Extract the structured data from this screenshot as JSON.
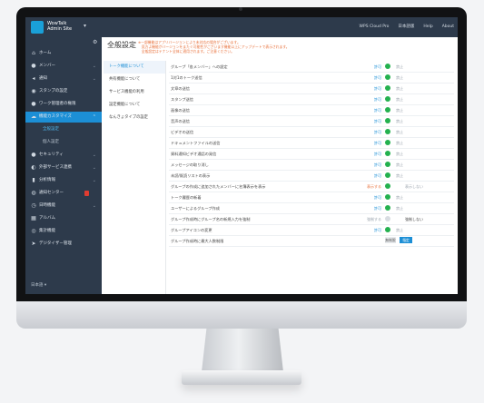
{
  "app": {
    "logo": {
      "line1": "WowTalk",
      "line2": "Admin Site"
    },
    "top_links": [
      "WPS Cloud Pro",
      "日本語版",
      "Help",
      "About"
    ]
  },
  "sidebar": {
    "items": [
      {
        "icon": "home-icon",
        "label": "ホーム"
      },
      {
        "icon": "user-icon",
        "label": "メンバー"
      },
      {
        "icon": "megaphone-icon",
        "label": "通知"
      },
      {
        "icon": "sticker-icon",
        "label": "スタンプの設定"
      },
      {
        "icon": "person-icon",
        "label": "ワーク管理者の権限"
      },
      {
        "icon": "cloud-icon",
        "label": "機能カスタマイズ"
      }
    ],
    "sub_items": [
      "全般設定",
      "個人設定"
    ],
    "items2": [
      {
        "icon": "shield-icon",
        "label": "セキュリティ"
      },
      {
        "icon": "service-icon",
        "label": "外部サービス連携"
      },
      {
        "icon": "chart-icon",
        "label": "分析情報"
      },
      {
        "icon": "support-icon",
        "label": "通知センター"
      },
      {
        "icon": "clock-icon",
        "label": "日時機能"
      },
      {
        "icon": "album-icon",
        "label": "アルバム"
      },
      {
        "icon": "target-icon",
        "label": "集計機能"
      },
      {
        "icon": "cursor-icon",
        "label": "デジタイザー管理"
      }
    ],
    "footer": "日本語 ▾"
  },
  "page": {
    "title": "全般設定",
    "notice_line1": "※一部機能はアプリバージョンにより未対応の場合がございます。",
    "notice_line2": "　見方よ機能がバージョンをまたぐ可能性がございます機能以上にアップデートで表示されます。",
    "notice_line3": "　全般設定はテナント全体に適用されます。ご注意ください。"
  },
  "subnav": [
    "トーク機能について",
    "共有機能について",
    "サービス機能の利用",
    "設定機能について",
    "なんきょタイプの設定"
  ],
  "settings": [
    {
      "label": "グループ「各メンバー」への設定",
      "on": "許可",
      "off": "禁止"
    },
    {
      "label": "1対1のトーク送信",
      "on": "許可",
      "off": "禁止"
    },
    {
      "label": "文章の送信",
      "on": "許可",
      "off": "禁止"
    },
    {
      "label": "スタンプ送信",
      "on": "許可",
      "off": "禁止"
    },
    {
      "label": "画像の送信",
      "on": "許可",
      "off": "禁止"
    },
    {
      "label": "音声の送信",
      "on": "許可",
      "off": "禁止"
    },
    {
      "label": "ビデオの送信",
      "on": "許可",
      "off": "禁止"
    },
    {
      "label": "ドキュメントファイルの送信",
      "on": "許可",
      "off": "禁止"
    },
    {
      "label": "資料通知ビデオ通話の発信",
      "on": "許可",
      "off": "禁止"
    },
    {
      "label": "メッセージの取り消し",
      "on": "許可",
      "off": "禁止"
    },
    {
      "label": "未読/既読リストの表示",
      "on": "許可",
      "off": "禁止"
    },
    {
      "label": "グループの作成に追加されたメンバーに名簿表示を表示",
      "on": "表示する",
      "off": "表示しない"
    },
    {
      "label": "トーク履歴の新着",
      "on": "許可",
      "off": "禁止"
    },
    {
      "label": "ユーザーによるグループ作成",
      "on": "許可",
      "off": "禁止"
    },
    {
      "label": "グループ作成時にグループ名の新規入力を強制",
      "on": "強制する",
      "off": "強制しない"
    },
    {
      "label": "グループアイコンの変更",
      "on": "許可",
      "off": "禁止"
    },
    {
      "label": "グループ作成時に最大人数制限",
      "seg_a": "無制限",
      "seg_b": "指定"
    }
  ]
}
